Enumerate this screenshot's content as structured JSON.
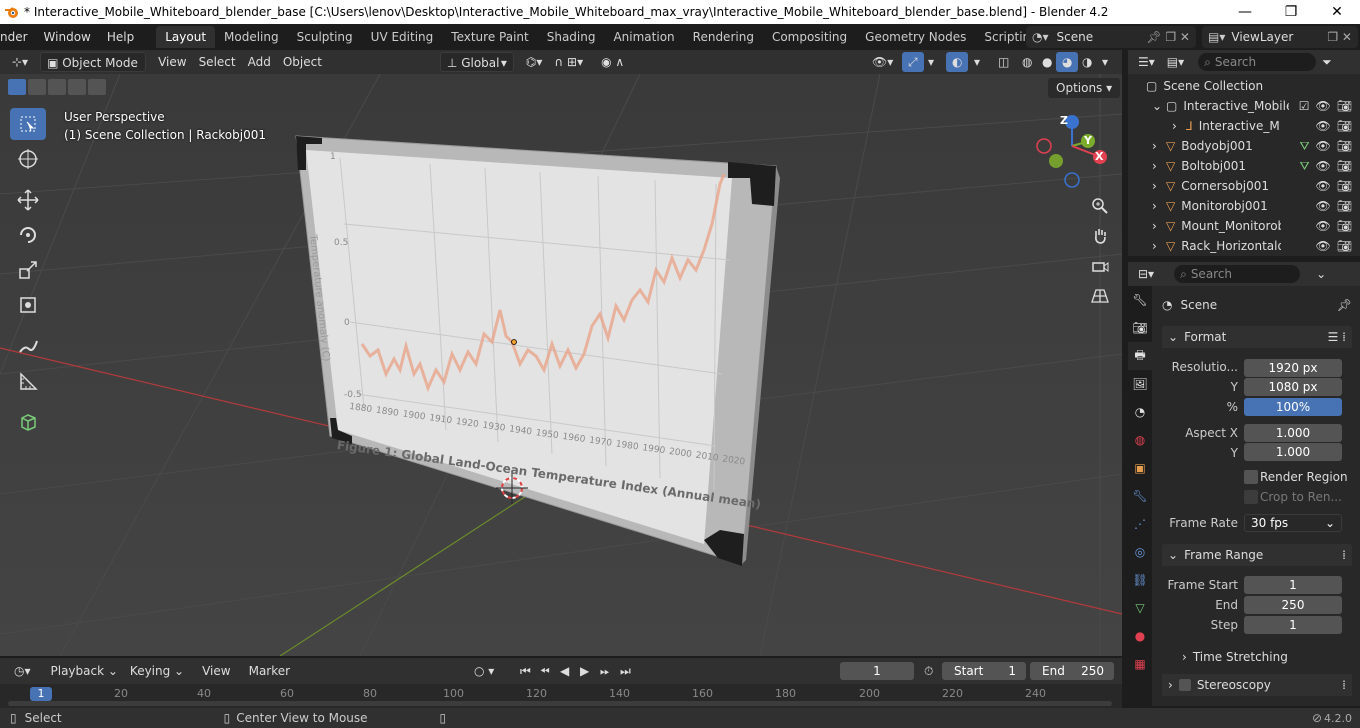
{
  "window": {
    "title": "* Interactive_Mobile_Whiteboard_blender_base [C:\\Users\\lenov\\Desktop\\Interactive_Mobile_Whiteboard_max_vray\\Interactive_Mobile_Whiteboard_blender_base.blend] - Blender 4.2",
    "minimize": "—",
    "maximize": "❐",
    "close": "✕"
  },
  "menu": [
    "nder",
    "Window",
    "Help"
  ],
  "workspaces": [
    "Layout",
    "Modeling",
    "Sculpting",
    "UV Editing",
    "Texture Paint",
    "Shading",
    "Animation",
    "Rendering",
    "Compositing",
    "Geometry Nodes",
    "Scripting"
  ],
  "scene_name": "Scene",
  "view_layer": "ViewLayer",
  "viewport_header": {
    "mode": "Object Mode",
    "menus": [
      "View",
      "Select",
      "Add",
      "Object"
    ],
    "orientation": "Global",
    "options": "Options"
  },
  "viewport": {
    "perspective": "User Perspective",
    "collection_info": "(1) Scene Collection | Rackobj001",
    "figure_caption": "Figure 1: Global Land-Ocean Temperature Index (Annual mean)",
    "y_axis_label": "Temperature anomaly (C)",
    "y_ticks": [
      "1",
      "0.5",
      "0",
      "-0.5"
    ],
    "x_ticks": [
      "1880",
      "1890",
      "1900",
      "1910",
      "1920",
      "1930",
      "1940",
      "1950",
      "1960",
      "1970",
      "1980",
      "1990",
      "2000",
      "2010",
      "2020"
    ],
    "gizmo": {
      "z": "Z",
      "y": "Y",
      "x": "X"
    }
  },
  "outliner": {
    "search_placeholder": "Search",
    "root": "Scene Collection",
    "rows": [
      {
        "name": "Interactive_Mobile_"
      },
      {
        "name": "Interactive_Mo"
      },
      {
        "name": "Bodyobj001"
      },
      {
        "name": "Boltobj001"
      },
      {
        "name": "Cornersobj001"
      },
      {
        "name": "Monitorobj001"
      },
      {
        "name": "Mount_Monitorobj"
      },
      {
        "name": "Rack_Horizontalobj"
      }
    ]
  },
  "properties": {
    "search_placeholder": "Search",
    "context": "Scene",
    "format_panel": "Format",
    "resolution_label": "Resolutio...",
    "resolution_x": "1920 px",
    "y_label": "Y",
    "resolution_y": "1080 px",
    "percent_label": "%",
    "percent": "100%",
    "aspect_x_label": "Aspect X",
    "aspect_x": "1.000",
    "aspect_y_label": "Y",
    "aspect_y": "1.000",
    "render_region": "Render Region",
    "crop": "Crop to Ren...",
    "frame_rate_label": "Frame Rate",
    "frame_rate": "30 fps",
    "frame_range_panel": "Frame Range",
    "frame_start_label": "Frame Start",
    "frame_start": "1",
    "end_label": "End",
    "end": "250",
    "step_label": "Step",
    "step": "1",
    "time_stretching": "Time Stretching",
    "stereoscopy": "Stereoscopy"
  },
  "timeline": {
    "menus": [
      "Playback",
      "Keying",
      "View",
      "Marker"
    ],
    "current_frame": "1",
    "start_label": "Start",
    "start": "1",
    "end_label": "End",
    "end": "250",
    "ruler": [
      "1",
      "20",
      "40",
      "60",
      "80",
      "100",
      "120",
      "140",
      "160",
      "180",
      "200",
      "220",
      "240"
    ]
  },
  "statusbar": {
    "select": "Select",
    "center_view": "Center View to Mouse",
    "version": "4.2.0"
  },
  "colors": {
    "accent": "#4772b3",
    "chart_line": "#e8a48a",
    "axis_red": "#b33a3a",
    "axis_green": "#6a8a2a"
  }
}
